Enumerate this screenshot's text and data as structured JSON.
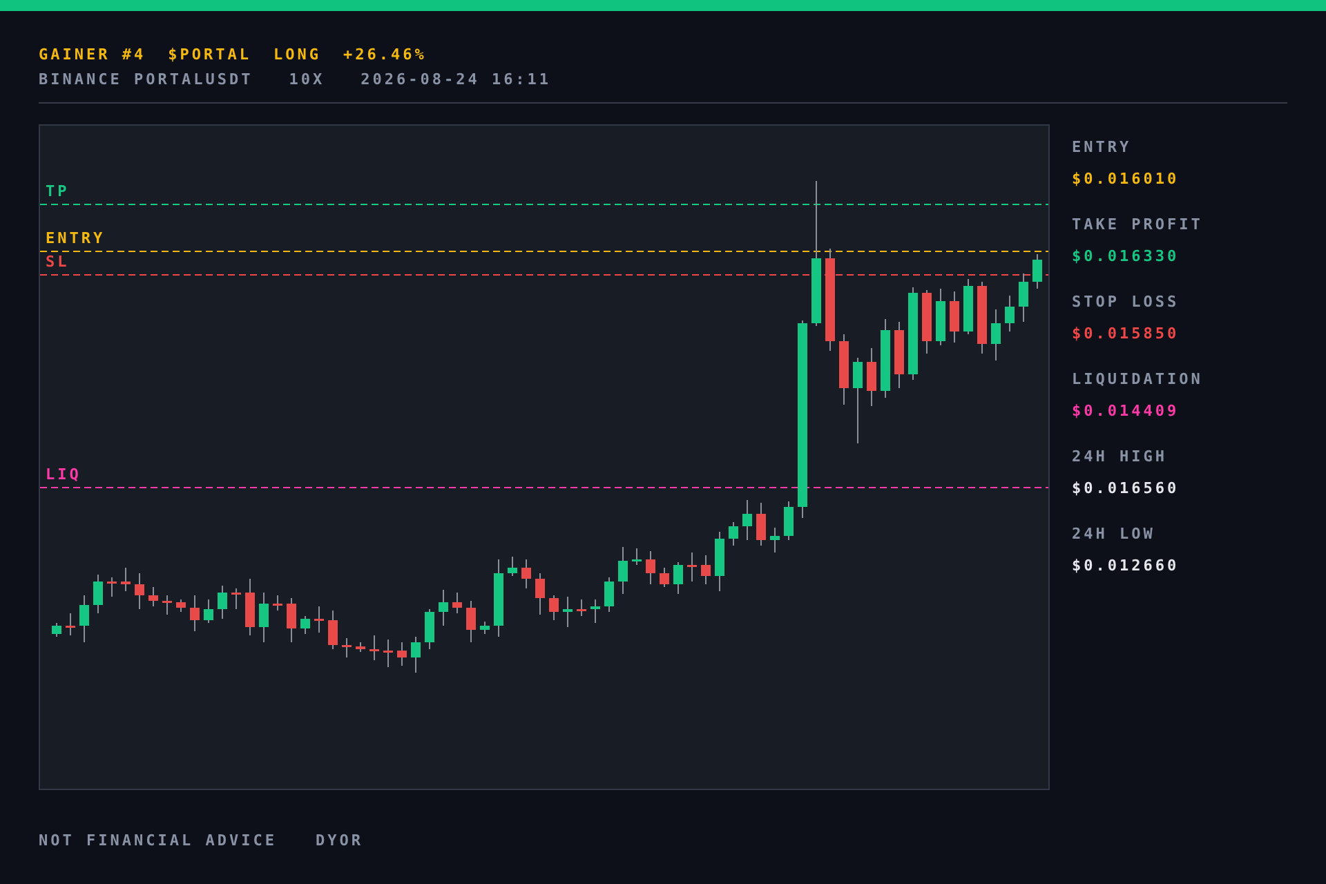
{
  "header": {
    "title_parts": [
      "GAINER #4",
      "$PORTAL",
      "LONG",
      "+26.46%"
    ],
    "subtitle_parts": [
      "BINANCE PORTALUSDT",
      "10X",
      "2026-08-24 16:11"
    ]
  },
  "chart": {
    "levels": [
      {
        "label": "TP",
        "kind": "tp"
      },
      {
        "label": "ENTRY",
        "kind": "entry"
      },
      {
        "label": "SL",
        "kind": "sl"
      },
      {
        "label": "LIQ",
        "kind": "liq"
      }
    ]
  },
  "stats": [
    {
      "label": "ENTRY",
      "value": "$0.016010",
      "kind": "entry"
    },
    {
      "label": "TAKE PROFIT",
      "value": "$0.016330",
      "kind": "tp"
    },
    {
      "label": "STOP LOSS",
      "value": "$0.015850",
      "kind": "sl"
    },
    {
      "label": "LIQUIDATION",
      "value": "$0.014409",
      "kind": "liq"
    },
    {
      "label": "24H HIGH",
      "value": "$0.016560",
      "kind": "high"
    },
    {
      "label": "24H LOW",
      "value": "$0.012660",
      "kind": "low"
    }
  ],
  "footer": [
    "NOT FINANCIAL ADVICE",
    "DYOR"
  ]
}
